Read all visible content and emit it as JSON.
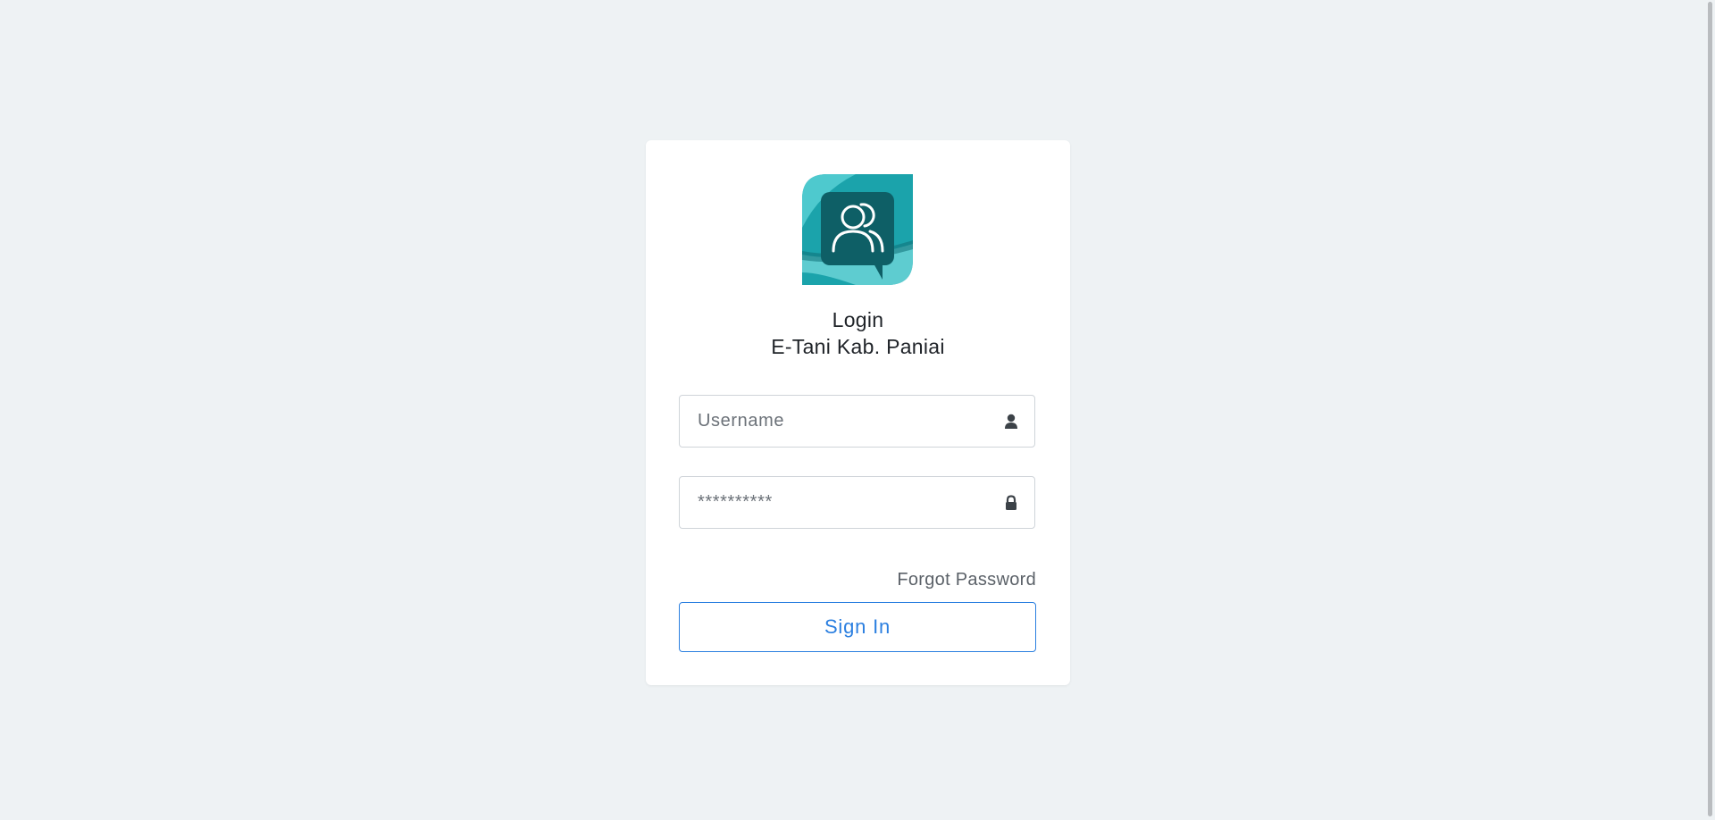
{
  "login": {
    "title": "Login",
    "subtitle": "E-Tani Kab. Paniai",
    "username": {
      "placeholder": "Username",
      "value": "",
      "icon": "user-icon"
    },
    "password": {
      "placeholder": "**********",
      "value": "",
      "icon": "lock-icon"
    },
    "forgot_label": "Forgot Password",
    "signin_label": "Sign In"
  },
  "colors": {
    "background": "#eef2f4",
    "card": "#ffffff",
    "accent": "#2b7fe0",
    "logo_teal": "#1ba3ab",
    "logo_dark": "#0e5f66"
  },
  "logo_icon": "chat-users-icon"
}
